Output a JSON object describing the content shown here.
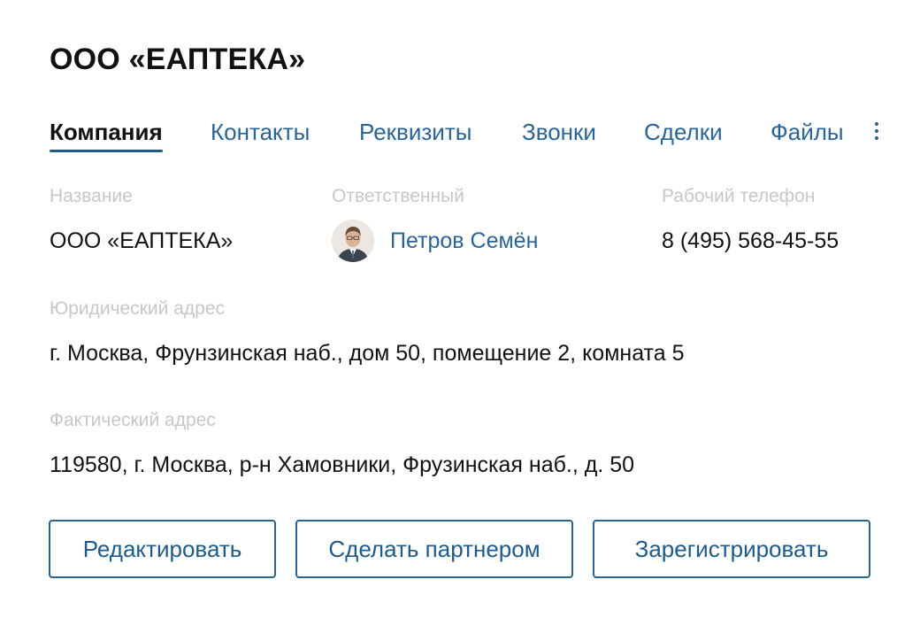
{
  "card": {
    "title": "ООО «ЕАПТЕКА»"
  },
  "tabs": [
    {
      "label": "Компания",
      "active": true
    },
    {
      "label": "Контакты"
    },
    {
      "label": "Реквизиты"
    },
    {
      "label": "Звонки"
    },
    {
      "label": "Сделки"
    },
    {
      "label": "Файлы"
    }
  ],
  "fields": {
    "name": {
      "label": "Название",
      "value": "ООО «ЕАПТЕКА»"
    },
    "responsible": {
      "label": "Ответственный",
      "value": "Петров Семён"
    },
    "phone": {
      "label": "Рабочий телефон",
      "value": "8 (495) 568-45-55"
    },
    "legal_address": {
      "label": "Юридический адрес",
      "value": "г. Москва, Фрунзинская наб., дом 50, помещение 2, комната 5"
    },
    "actual_address": {
      "label": "Фактический адрес",
      "value": "119580, г. Москва, р-н Хамовники, Фрузинская наб., д. 50"
    }
  },
  "actions": {
    "edit": "Редактировать",
    "make_partner": "Сделать партнером",
    "register": "Зарегистрировать"
  },
  "icons": {
    "more": "more-vertical-icon",
    "avatar": "user-avatar"
  },
  "colors": {
    "accent": "#2a6496",
    "label": "#c4c7cc",
    "text": "#111111"
  }
}
